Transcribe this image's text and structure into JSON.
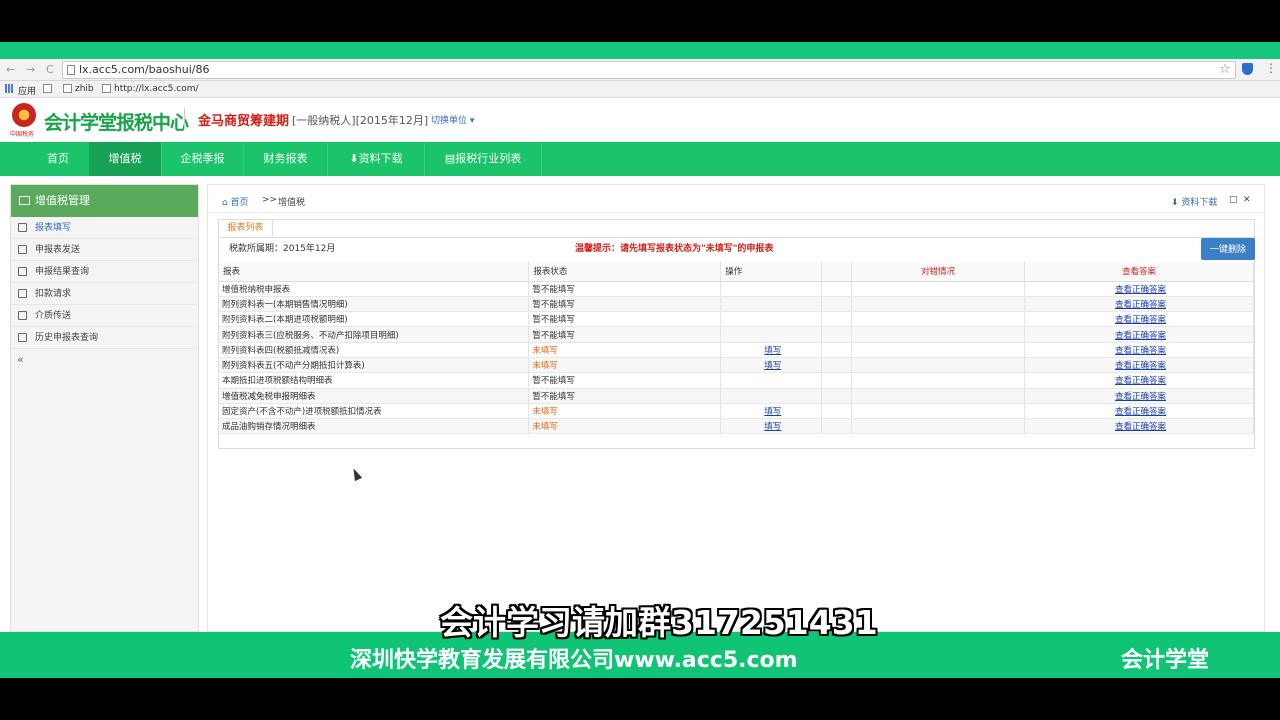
{
  "browser": {
    "url": "lx.acc5.com/baoshui/86",
    "back": "←",
    "forward": "→",
    "reload": "C",
    "bookmarks": [
      "应用",
      "zhib",
      "http://lx.acc5.com/"
    ]
  },
  "header": {
    "logo_text": "会计学堂报税中心",
    "emblem_caption": "中国税务",
    "company_name": "金马商贸筹建期",
    "company_type": "[一般纳税人][2015年12月]",
    "switch_unit": "切换单位 ▾"
  },
  "nav": {
    "items": [
      {
        "label": "首页"
      },
      {
        "label": "增值税"
      },
      {
        "label": "企税季报"
      },
      {
        "label": "财务报表"
      },
      {
        "label": "⬇资料下载"
      },
      {
        "label": "▤报税行业列表"
      }
    ]
  },
  "sidebar": {
    "title": "增值税管理",
    "items": [
      {
        "label": "报表填写"
      },
      {
        "label": "申报表发送"
      },
      {
        "label": "申报结果查询"
      },
      {
        "label": "扣款请求"
      },
      {
        "label": "介质传送"
      },
      {
        "label": "历史申报表查询"
      }
    ],
    "collapse": "«"
  },
  "breadcrumb": {
    "home": "⌂ 首页",
    "sep": ">>",
    "current": "增值税",
    "download": "⬇ 资料下载",
    "maximize": "□",
    "close": "✕"
  },
  "panel": {
    "tab": "报表列表",
    "period": "税款所属期：2015年12月",
    "warning": "温馨提示：请先填写报表状态为\"未填写\"的申报表",
    "clear_button": "一键删除",
    "columns": [
      "报表",
      "报表状态",
      "操作",
      "",
      "对错情况",
      "查看答案"
    ],
    "rows": [
      {
        "name": "增值税纳税申报表",
        "status": "暂不能填写",
        "op": "",
        "answer": "查看正确答案"
      },
      {
        "name": "附列资料表一(本期销售情况明细)",
        "status": "暂不能填写",
        "op": "",
        "answer": "查看正确答案"
      },
      {
        "name": "附列资料表二(本期进项税额明细)",
        "status": "暂不能填写",
        "op": "",
        "answer": "查看正确答案"
      },
      {
        "name": "附列资料表三(应税服务、不动产扣除项目明细)",
        "status": "暂不能填写",
        "op": "",
        "answer": "查看正确答案"
      },
      {
        "name": "附列资料表四(税额抵减情况表)",
        "status": "未填写",
        "op": "填写",
        "answer": "查看正确答案"
      },
      {
        "name": "附列资料表五(不动产分期抵扣计算表)",
        "status": "未填写",
        "op": "填写",
        "answer": "查看正确答案"
      },
      {
        "name": "本期抵扣进项税额结构明细表",
        "status": "暂不能填写",
        "op": "",
        "answer": "查看正确答案"
      },
      {
        "name": "增值税减免税申报明细表",
        "status": "暂不能填写",
        "op": "",
        "answer": "查看正确答案"
      },
      {
        "name": "固定资产(不含不动产)进项税额抵扣情况表",
        "status": "未填写",
        "op": "填写",
        "answer": "查看正确答案"
      },
      {
        "name": "成品油购销存情况明细表",
        "status": "未填写",
        "op": "填写",
        "answer": "查看正确答案"
      }
    ]
  },
  "overlay": {
    "subtitle": "会计学习请加群317251431",
    "company_footer": "深圳快学教育发展有限公司www.acc5.com",
    "brand_footer": "会计学堂"
  },
  "colors": {
    "brand_green": "#1bc46a",
    "nav_active": "#17a256",
    "warning_red": "#d0211b",
    "status_orange": "#e86a10",
    "link_blue": "#1a3fb0"
  }
}
